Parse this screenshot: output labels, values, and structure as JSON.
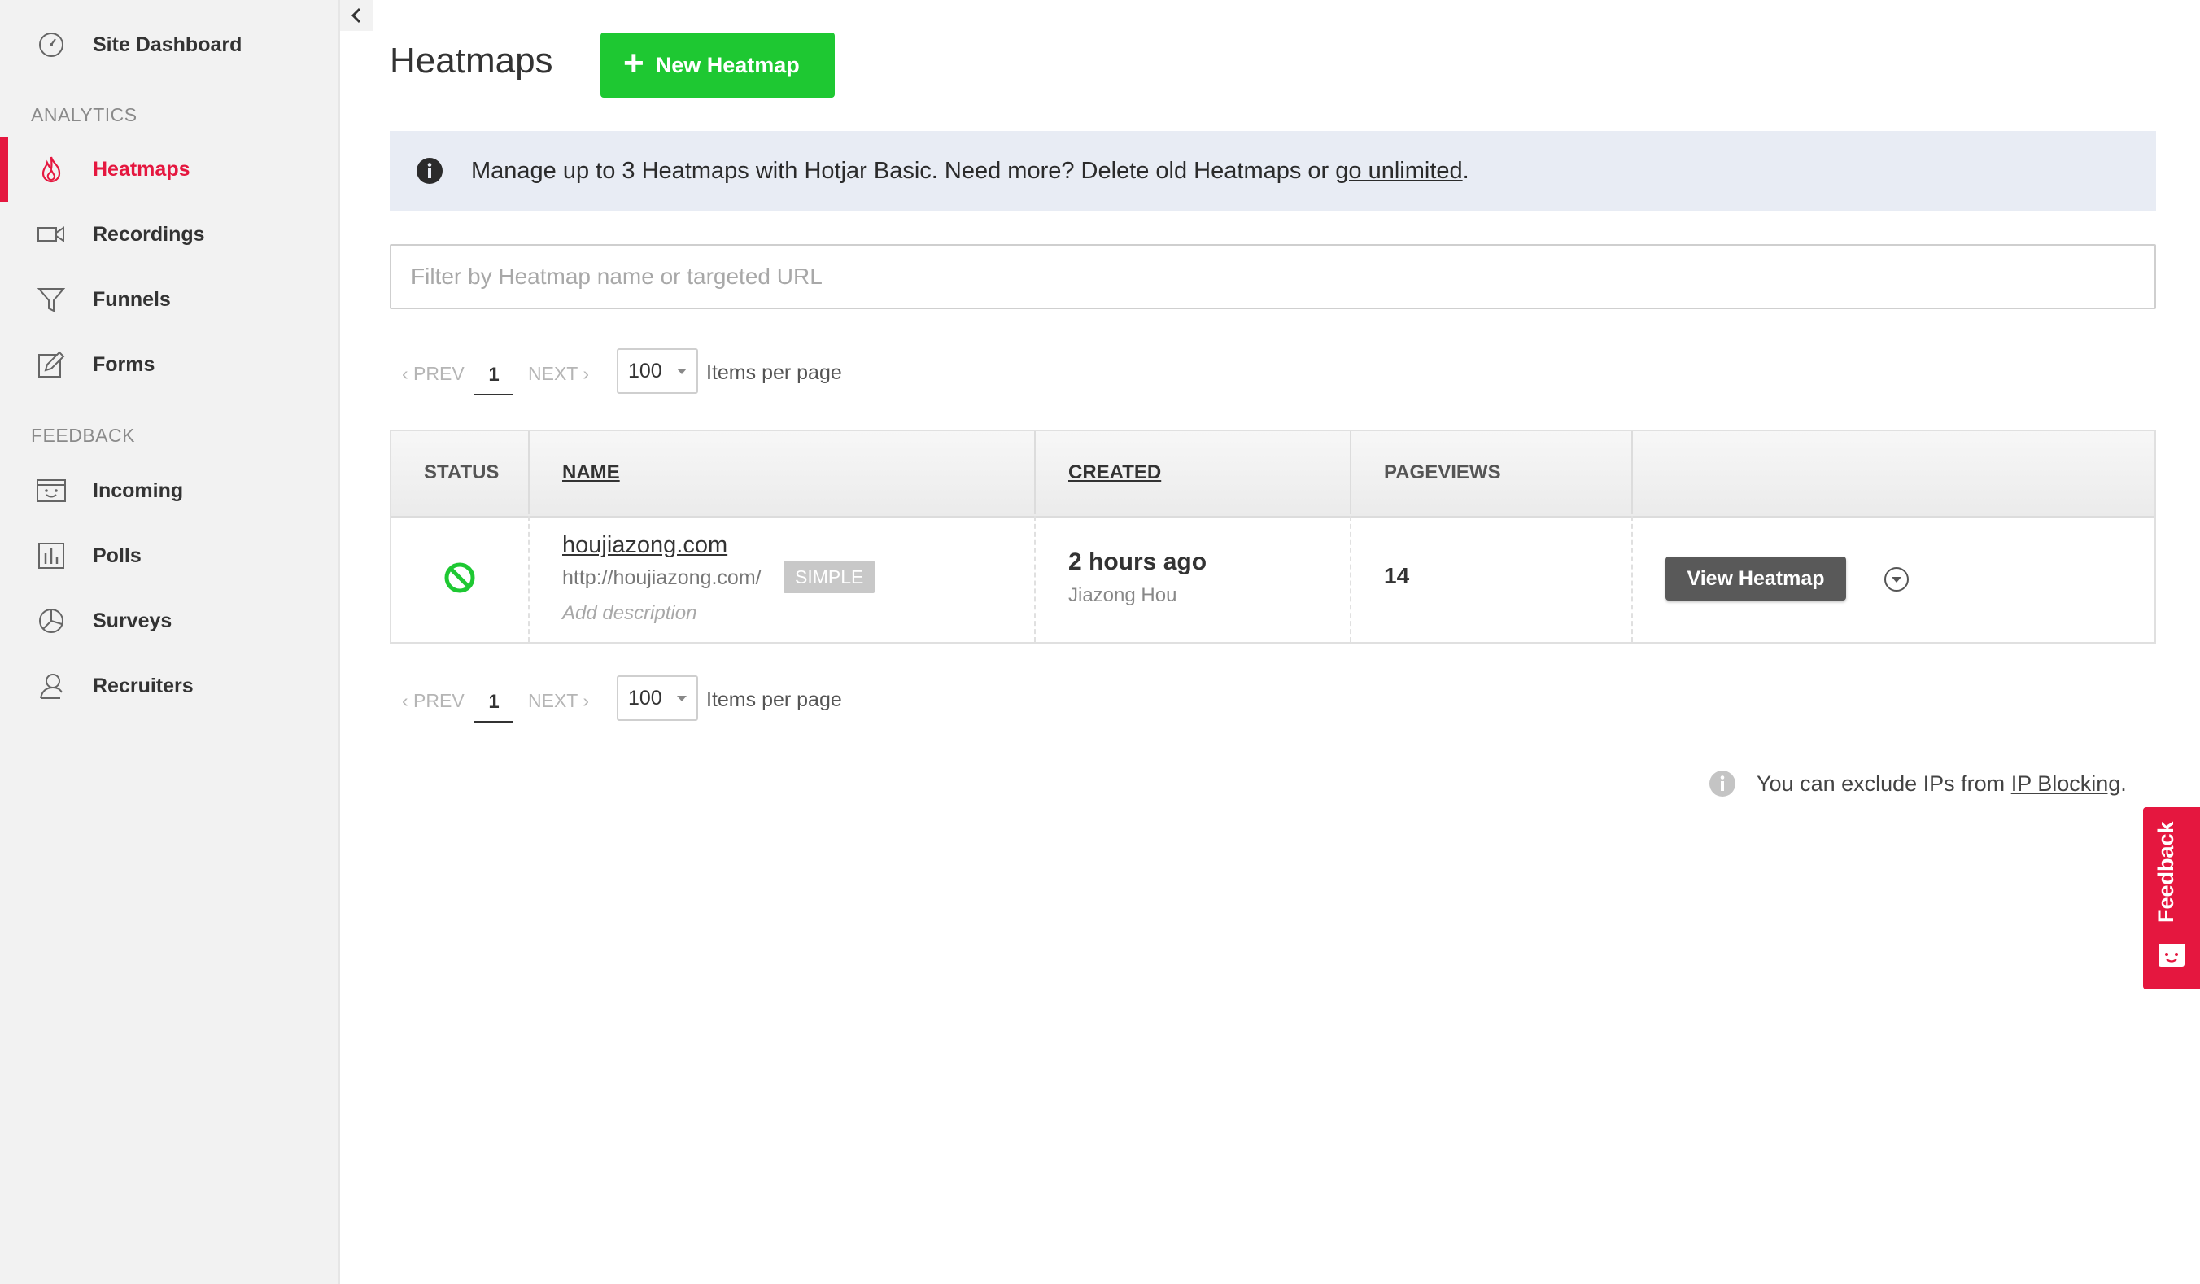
{
  "sidebar": {
    "site_dashboard": "Site Dashboard",
    "analytics_label": "ANALYTICS",
    "feedback_label": "FEEDBACK",
    "analytics_items": [
      {
        "label": "Heatmaps",
        "icon": "flame-icon",
        "active": true
      },
      {
        "label": "Recordings",
        "icon": "video-camera-icon"
      },
      {
        "label": "Funnels",
        "icon": "funnel-icon"
      },
      {
        "label": "Forms",
        "icon": "form-edit-icon"
      }
    ],
    "feedback_items": [
      {
        "label": "Incoming",
        "icon": "inbox-face-icon"
      },
      {
        "label": "Polls",
        "icon": "bar-chart-icon"
      },
      {
        "label": "Surveys",
        "icon": "pie-chart-icon"
      },
      {
        "label": "Recruiters",
        "icon": "user-icon"
      }
    ]
  },
  "header": {
    "title": "Heatmaps",
    "new_button": "New Heatmap"
  },
  "banner": {
    "text": "Manage up to 3 Heatmaps with Hotjar Basic. Need more? Delete old Heatmaps or ",
    "link": "go unlimited",
    "suffix": "."
  },
  "filter": {
    "placeholder": "Filter by Heatmap name or targeted URL",
    "value": ""
  },
  "pagination": {
    "prev": "‹ PREV",
    "page": "1",
    "next": "NEXT ›",
    "per_page": "100",
    "per_page_label": "Items per page"
  },
  "table": {
    "headers": {
      "status": "STATUS",
      "name": "NAME",
      "created": "CREATED",
      "pageviews": "PAGEVIEWS"
    },
    "rows": [
      {
        "name": "houjiazong.com",
        "url": "http://houjiazong.com/",
        "badge": "SIMPLE",
        "description_placeholder": "Add description",
        "created": "2 hours ago",
        "created_by": "Jiazong Hou",
        "pageviews": "14",
        "action": "View Heatmap",
        "status_color": "#1ec832"
      }
    ]
  },
  "ip_note": {
    "text": "You can exclude IPs from ",
    "link": "IP Blocking",
    "suffix": "."
  },
  "feedback_tab": "Feedback",
  "colors": {
    "accent": "#e5173f",
    "primary_button": "#1ec832",
    "banner_bg": "#e8ecf4"
  }
}
